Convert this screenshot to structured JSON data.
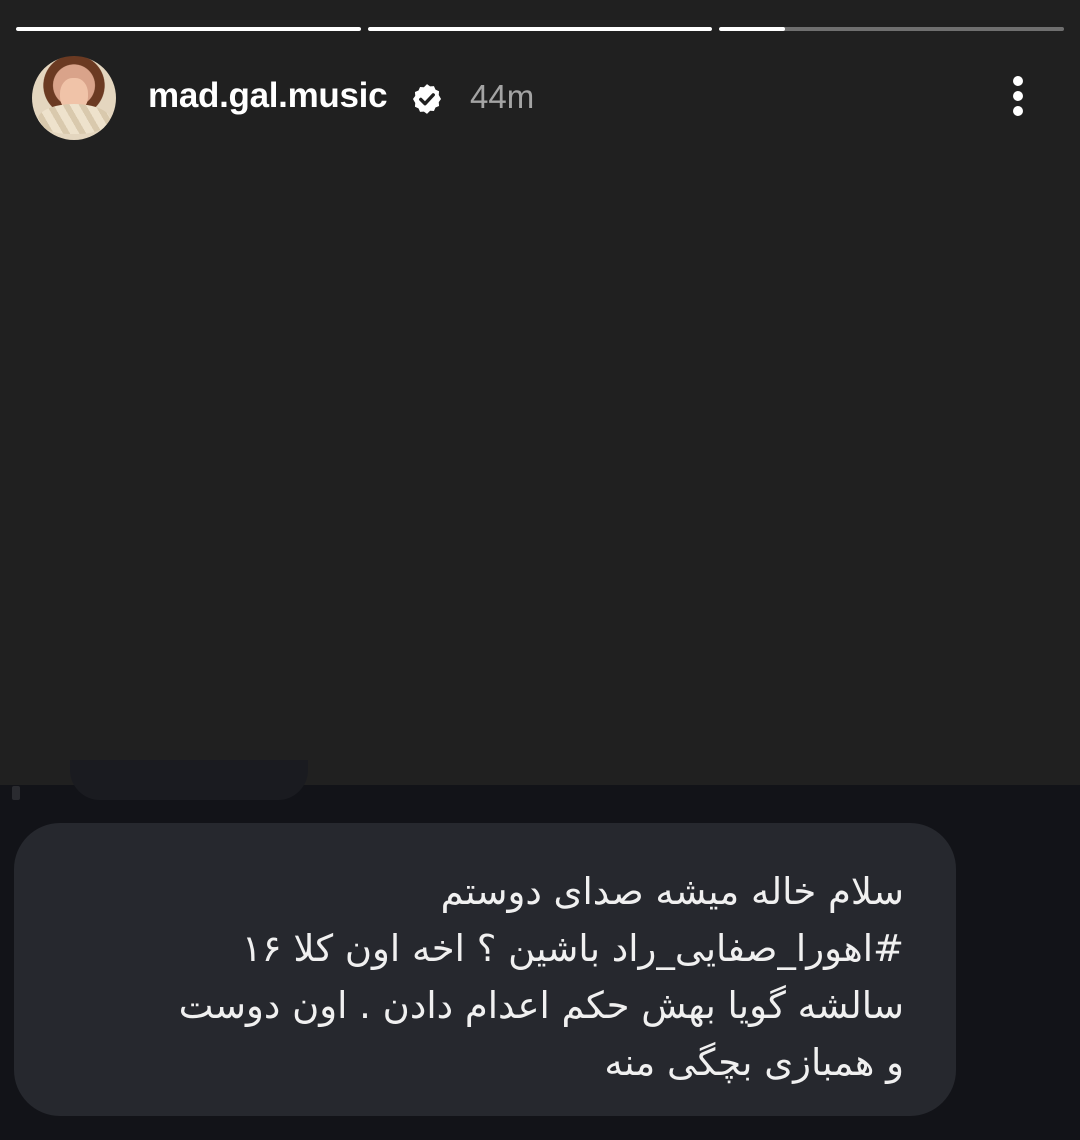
{
  "story": {
    "progress": [
      1,
      1,
      0.19
    ],
    "username": "mad.gal.music",
    "verified_icon": "verified-badge-icon",
    "time": "44m",
    "menu_icon": "more-vertical-icon",
    "avatar_icon": "profile-avatar"
  },
  "message": {
    "lines": [
      "سلام خاله میشه صدای دوستم",
      "#اهورا_صفایی_راد باشین ؟ اخه اون کلا ۱۶",
      "سالشه گویا بهش حکم اعدام دادن  . اون دوست",
      "و همبازی بچگی منه"
    ]
  },
  "colors": {
    "story_bg": "#202020",
    "page_bg": "#121318",
    "bubble_bg": "#26282e",
    "progress_track": "#6f6f6f",
    "progress_fill": "#ffffff"
  }
}
